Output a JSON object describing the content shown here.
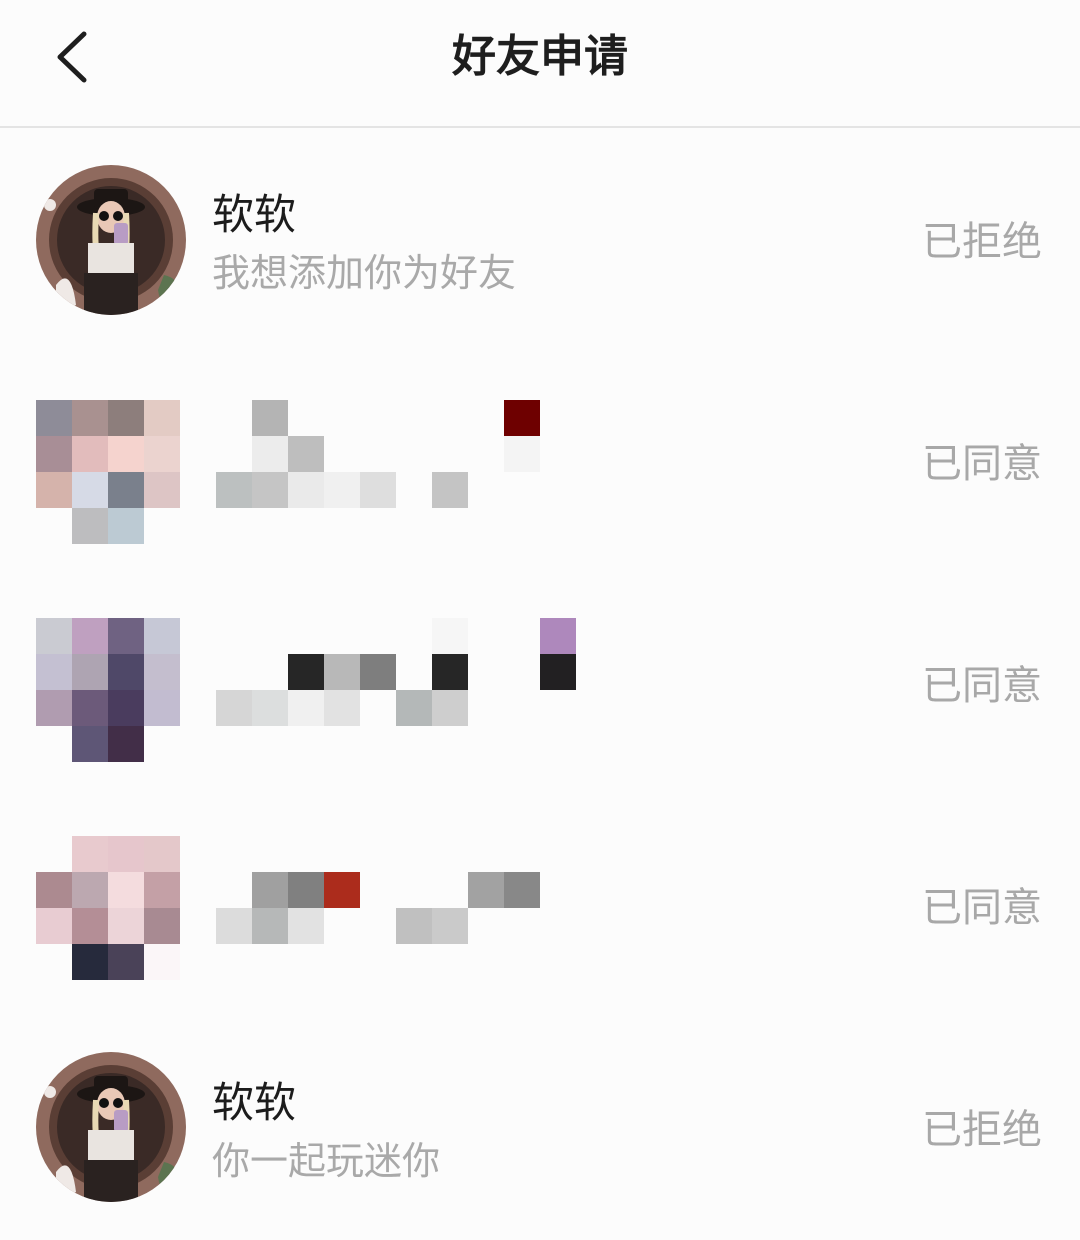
{
  "header": {
    "title": "好友申请",
    "back_icon": "chevron-left-icon"
  },
  "requests": [
    {
      "name": "软软",
      "message": "我想添加你为好友",
      "status": "已拒绝",
      "avatar": "profile-photo"
    },
    {
      "name": "",
      "message": "",
      "status": "已同意",
      "avatar": "mosaic-censored"
    },
    {
      "name": "",
      "message": "",
      "status": "已同意",
      "avatar": "mosaic-censored"
    },
    {
      "name": "",
      "message": "",
      "status": "已同意",
      "avatar": "mosaic-censored"
    },
    {
      "name": "软软",
      "message": "你一起玩迷你",
      "status": "已拒绝",
      "avatar": "profile-photo"
    }
  ],
  "colors": {
    "background": "#fcfcfc",
    "title_text": "#1e1e1e",
    "secondary_text": "#a9a9a9",
    "divider": "#e4e4e4"
  }
}
